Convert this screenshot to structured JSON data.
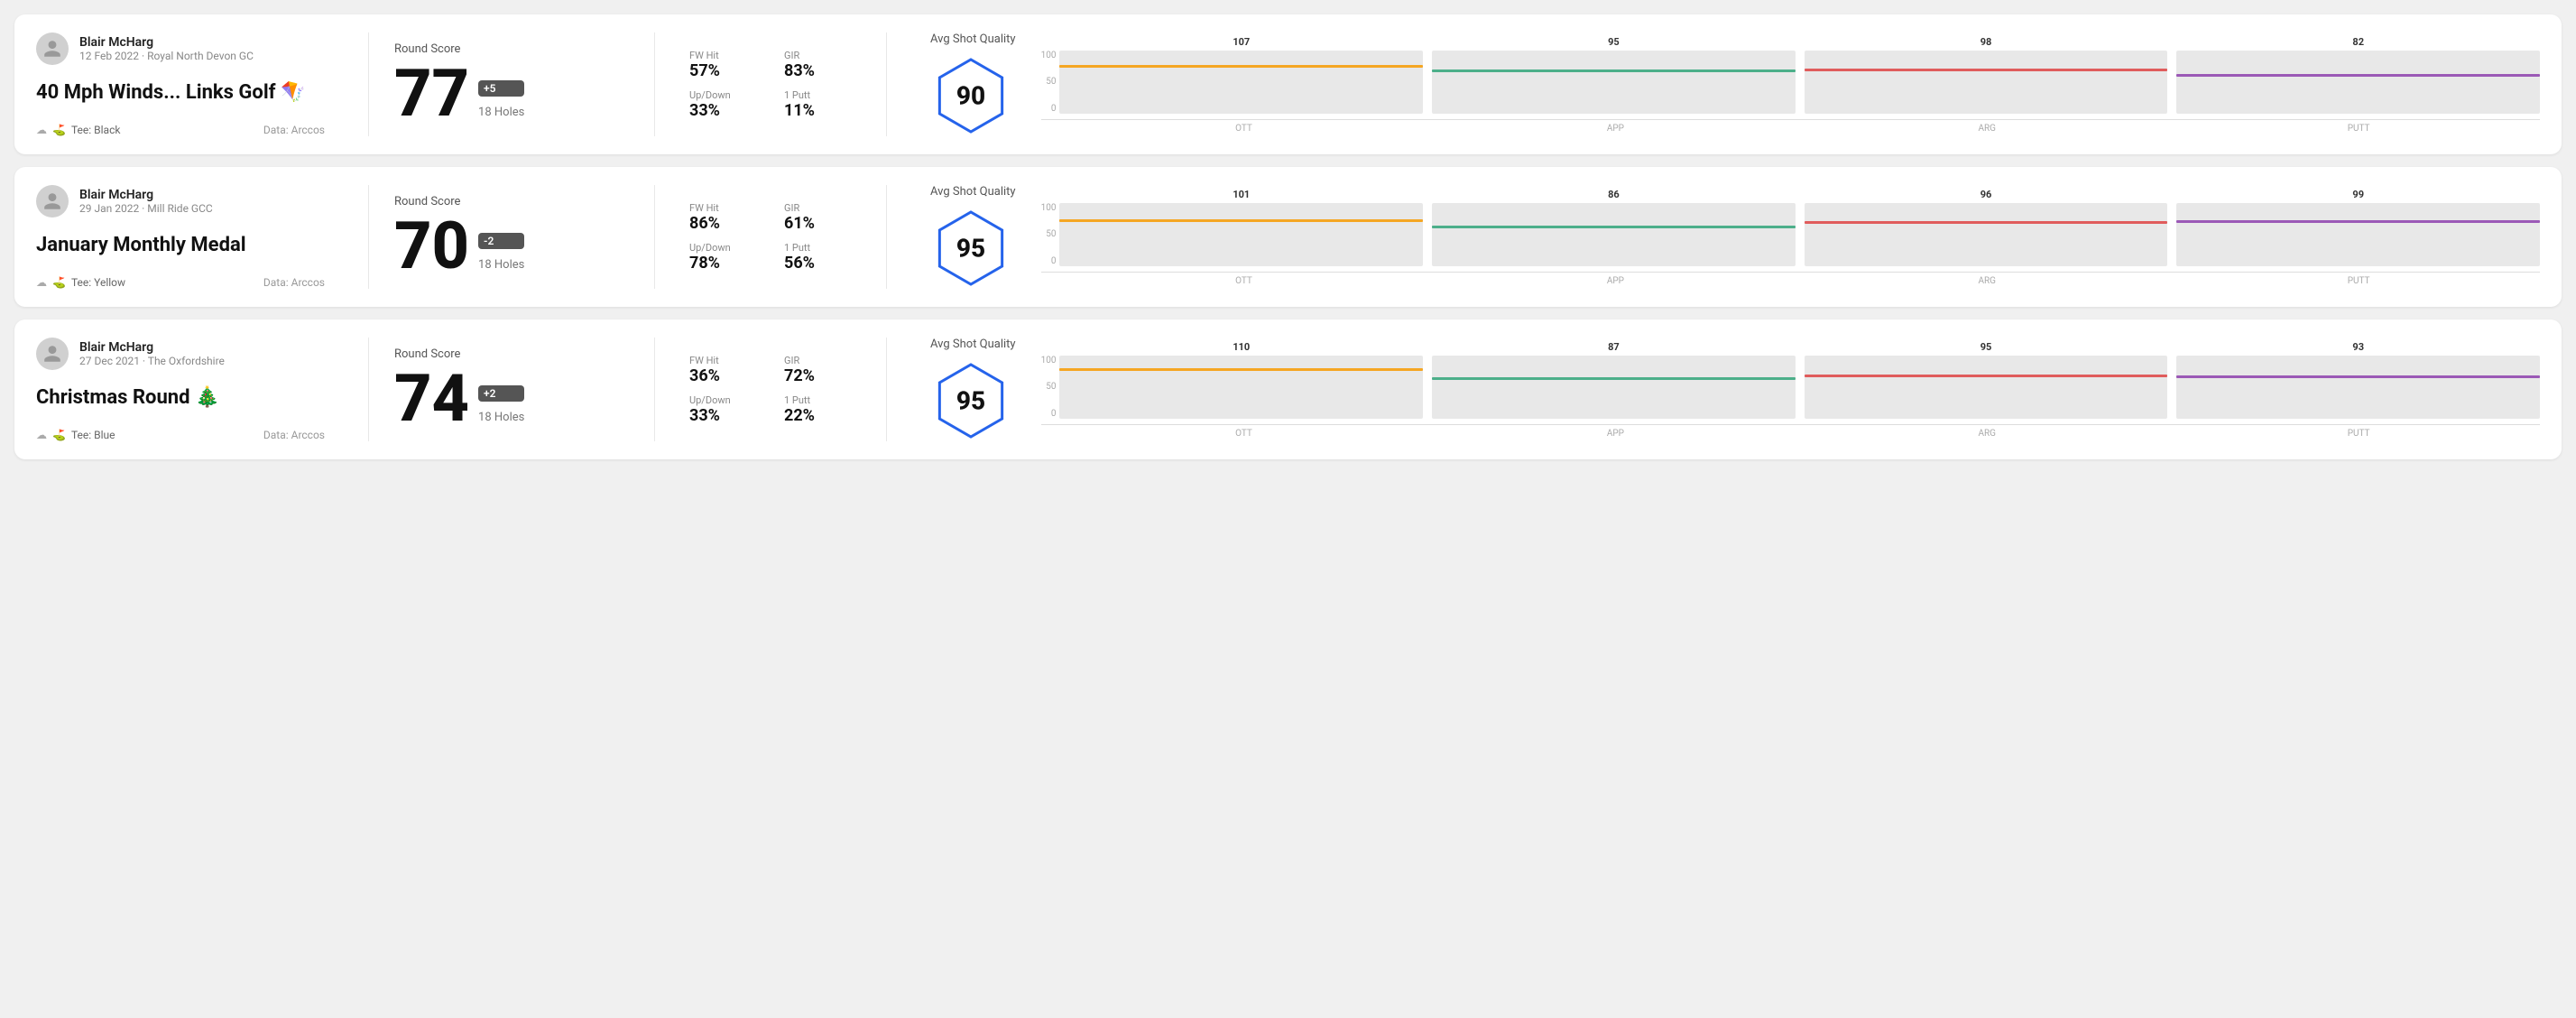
{
  "rounds": [
    {
      "id": "round1",
      "user": {
        "name": "Blair McHarg",
        "date": "12 Feb 2022",
        "course": "Royal North Devon GC"
      },
      "title": "40 Mph Winds... Links Golf 🪁",
      "tee": "Black",
      "data_source": "Data: Arccos",
      "score": {
        "label": "Round Score",
        "value": "77",
        "badge": "+5",
        "badge_type": "positive",
        "holes": "18 Holes"
      },
      "stats": {
        "fw_hit_label": "FW Hit",
        "fw_hit_value": "57%",
        "gir_label": "GIR",
        "gir_value": "83%",
        "updown_label": "Up/Down",
        "updown_value": "33%",
        "oneputt_label": "1 Putt",
        "oneputt_value": "11%"
      },
      "quality": {
        "label": "Avg Shot Quality",
        "score": "90",
        "chart": {
          "columns": [
            {
              "label": "OTT",
              "value": 107,
              "color": "#f5a623",
              "bar_pct": 72
            },
            {
              "label": "APP",
              "value": 95,
              "color": "#4caf8a",
              "bar_pct": 65
            },
            {
              "label": "ARG",
              "value": 98,
              "color": "#e05c5c",
              "bar_pct": 67
            },
            {
              "label": "PUTT",
              "value": 82,
              "color": "#9b59b6",
              "bar_pct": 58
            }
          ],
          "y_labels": [
            "100",
            "50",
            "0"
          ]
        }
      }
    },
    {
      "id": "round2",
      "user": {
        "name": "Blair McHarg",
        "date": "29 Jan 2022",
        "course": "Mill Ride GCC"
      },
      "title": "January Monthly Medal",
      "tee": "Yellow",
      "data_source": "Data: Arccos",
      "score": {
        "label": "Round Score",
        "value": "70",
        "badge": "-2",
        "badge_type": "negative",
        "holes": "18 Holes"
      },
      "stats": {
        "fw_hit_label": "FW Hit",
        "fw_hit_value": "86%",
        "gir_label": "GIR",
        "gir_value": "61%",
        "updown_label": "Up/Down",
        "updown_value": "78%",
        "oneputt_label": "1 Putt",
        "oneputt_value": "56%"
      },
      "quality": {
        "label": "Avg Shot Quality",
        "score": "95",
        "chart": {
          "columns": [
            {
              "label": "OTT",
              "value": 101,
              "color": "#f5a623",
              "bar_pct": 70
            },
            {
              "label": "APP",
              "value": 86,
              "color": "#4caf8a",
              "bar_pct": 60
            },
            {
              "label": "ARG",
              "value": 96,
              "color": "#e05c5c",
              "bar_pct": 66
            },
            {
              "label": "PUTT",
              "value": 99,
              "color": "#9b59b6",
              "bar_pct": 68
            }
          ],
          "y_labels": [
            "100",
            "50",
            "0"
          ]
        }
      }
    },
    {
      "id": "round3",
      "user": {
        "name": "Blair McHarg",
        "date": "27 Dec 2021",
        "course": "The Oxfordshire"
      },
      "title": "Christmas Round 🎄",
      "tee": "Blue",
      "data_source": "Data: Arccos",
      "score": {
        "label": "Round Score",
        "value": "74",
        "badge": "+2",
        "badge_type": "positive",
        "holes": "18 Holes"
      },
      "stats": {
        "fw_hit_label": "FW Hit",
        "fw_hit_value": "36%",
        "gir_label": "GIR",
        "gir_value": "72%",
        "updown_label": "Up/Down",
        "updown_value": "33%",
        "oneputt_label": "1 Putt",
        "oneputt_value": "22%"
      },
      "quality": {
        "label": "Avg Shot Quality",
        "score": "95",
        "chart": {
          "columns": [
            {
              "label": "OTT",
              "value": 110,
              "color": "#f5a623",
              "bar_pct": 75
            },
            {
              "label": "APP",
              "value": 87,
              "color": "#4caf8a",
              "bar_pct": 61
            },
            {
              "label": "ARG",
              "value": 95,
              "color": "#e05c5c",
              "bar_pct": 65
            },
            {
              "label": "PUTT",
              "value": 93,
              "color": "#9b59b6",
              "bar_pct": 64
            }
          ],
          "y_labels": [
            "100",
            "50",
            "0"
          ]
        }
      }
    }
  ]
}
